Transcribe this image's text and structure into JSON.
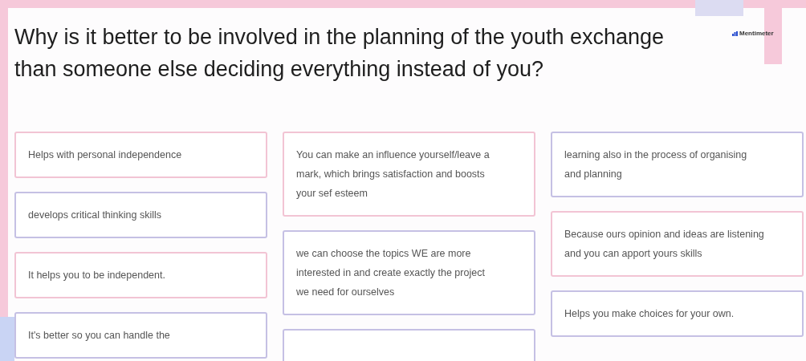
{
  "slide": {
    "title": "Why is it better to be involved in the planning of the youth exchange than someone else deciding everything instead of you?",
    "brand": "Mentimeter"
  },
  "columns": [
    {
      "cards": [
        {
          "kind": "answer",
          "text": "Helps with personal independence",
          "color": "#f2c4d4"
        },
        {
          "kind": "answer",
          "text": "develops critical thinking skills",
          "color": "#c5c0e4"
        },
        {
          "kind": "answer",
          "text": "It helps you to be independent.",
          "color": "#f2c4d4"
        },
        {
          "kind": "answer",
          "text": "It's better so you can handle the",
          "color": "#c5c0e4"
        }
      ]
    },
    {
      "cards": [
        {
          "kind": "answer",
          "text": "You can make an influence yourself/leave a mark, which brings satisfaction and boosts your sef esteem",
          "color": "#f2c4d4"
        },
        {
          "kind": "answer",
          "text": "we can choose the topics WE are more interested in and create exactly the project we need for ourselves",
          "color": "#c5c0e4"
        },
        {
          "kind": "blank",
          "color": "#c5c0e4"
        }
      ]
    },
    {
      "cards": [
        {
          "kind": "answer",
          "text": "learning also in the process of organising and planning",
          "color": "#c5c0e4"
        },
        {
          "kind": "answer",
          "text": "Because ours opinion and ideas are listening and you can apport yours skills",
          "color": "#f2c4d4"
        },
        {
          "kind": "answer",
          "text": "Helps you make choices for your own.",
          "color": "#c5c0e4"
        }
      ]
    }
  ]
}
